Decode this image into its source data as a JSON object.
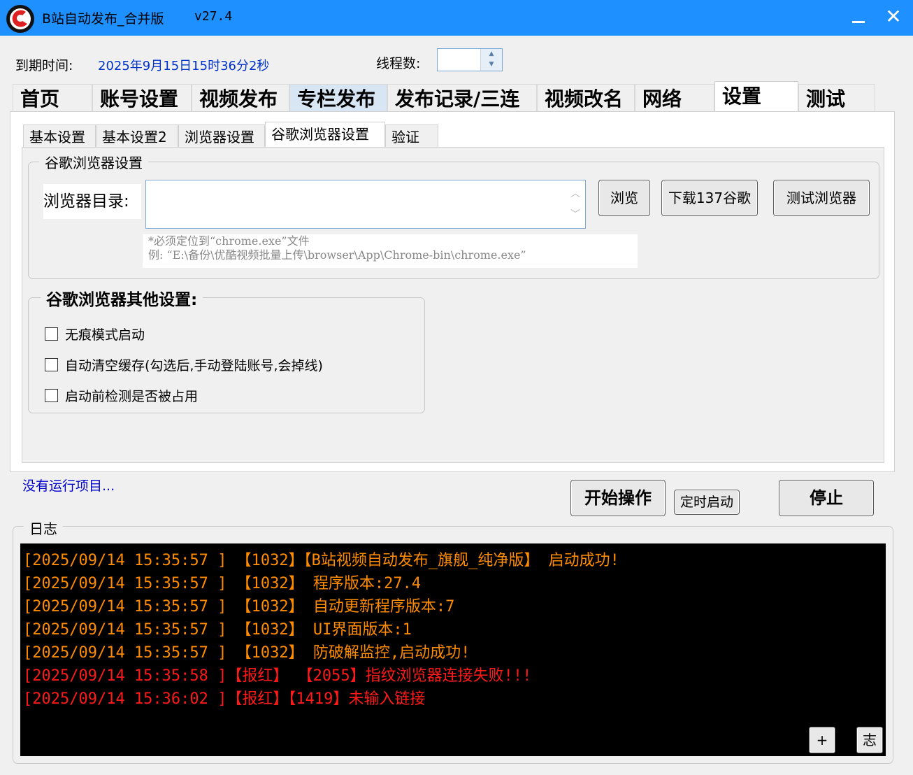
{
  "window": {
    "title": "B站自动发布_合并版",
    "version": "v27.4",
    "accent_color": "#1e90ff"
  },
  "top": {
    "expire_label": "到期时间:",
    "expire_value": "2025年9月15日15时36分2秒",
    "thread_label": "线程数:",
    "thread_value": ""
  },
  "main_tabs": [
    "首页",
    "账号设置",
    "视频发布",
    "专栏发布",
    "发布记录/三连",
    "视频改名",
    "网络",
    "设置",
    "测试"
  ],
  "main_tab_active": "设置",
  "sub_tabs": [
    "基本设置",
    "基本设置2",
    "浏览器设置",
    "谷歌浏览器设置",
    "验证"
  ],
  "sub_tab_active": "谷歌浏览器设置",
  "chrome_group": {
    "title": "谷歌浏览器设置",
    "dir_label": "浏览器目录:",
    "dir_value": "",
    "browse_button": "浏览",
    "download_button": "下载137谷歌",
    "test_button": "测试浏览器",
    "hint_line1": "*必须定位到“chrome.exe”文件",
    "hint_line2": "例: “E:\\备份\\优酷视频批量上传\\browser\\App\\Chrome-bin\\chrome.exe”"
  },
  "other_group": {
    "title": "谷歌浏览器其他设置:",
    "options": [
      {
        "label": "无痕模式启动",
        "checked": false
      },
      {
        "label": "自动清空缓存(勾选后,手动登陆账号,会掉线)",
        "checked": false
      },
      {
        "label": "启动前检测是否被占用",
        "checked": false
      }
    ]
  },
  "status": {
    "text": "没有运行项目..."
  },
  "actions": {
    "start": "开始操作",
    "schedule": "定时启动",
    "stop": "停止"
  },
  "log": {
    "title": "日志",
    "lines": [
      {
        "text": "[2025/09/14 15:35:57 ] 【1032】【B站视频自动发布_旗舰_纯净版】 启动成功!",
        "color": "#ff8c00"
      },
      {
        "text": "[2025/09/14 15:35:57 ] 【1032】 程序版本:27.4",
        "color": "#ff8c00"
      },
      {
        "text": "[2025/09/14 15:35:57 ] 【1032】 自动更新程序版本:7",
        "color": "#ff8c00"
      },
      {
        "text": "[2025/09/14 15:35:57 ] 【1032】 UI界面版本:1",
        "color": "#ff8c00"
      },
      {
        "text": "[2025/09/14 15:35:57 ] 【1032】 防破解监控,启动成功!",
        "color": "#ff8c00"
      },
      {
        "text": "[2025/09/14 15:35:58 ]【报红】 【2055】指纹浏览器连接失败!!!",
        "color": "#ff1a1a"
      },
      {
        "text": "[2025/09/14 15:36:02 ]【报红】【1419】未输入链接",
        "color": "#ff1a1a"
      }
    ],
    "plus_button": "+",
    "zhi_button": "志"
  }
}
